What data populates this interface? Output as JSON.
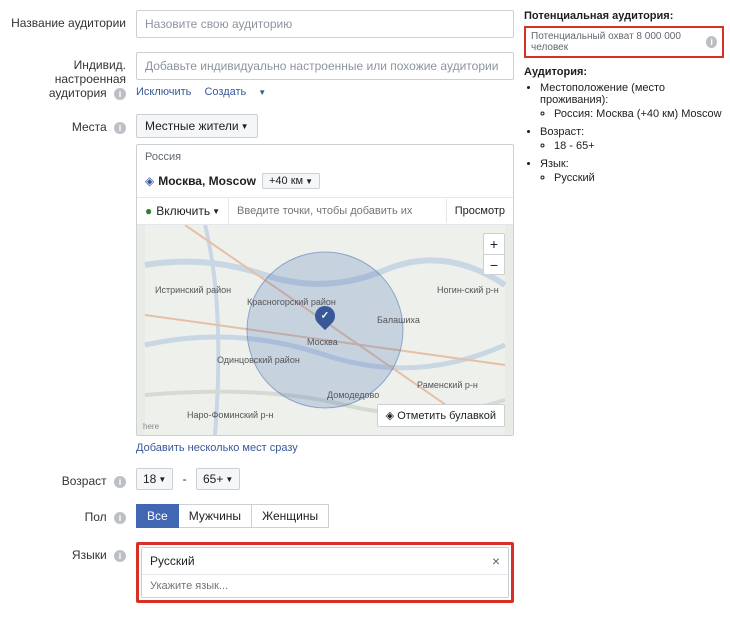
{
  "labels": {
    "audience_name": "Название аудитории",
    "custom_audience": "Индивид. настроенная аудитория",
    "locations": "Места",
    "age": "Возраст",
    "gender": "Пол",
    "languages": "Языки"
  },
  "audience_name": {
    "placeholder": "Назовите свою аудиторию"
  },
  "custom_audience": {
    "placeholder": "Добавьте индивидуально настроенные или похожие аудитории",
    "exclude": "Исключить",
    "create": "Создать"
  },
  "locations": {
    "residents_label": "Местные жители",
    "country": "Россия",
    "city": "Москва, Moscow",
    "radius": "+40 км",
    "include": "Включить",
    "points_placeholder": "Введите точки, чтобы добавить их",
    "browse": "Просмотр",
    "drop_pin": "Отметить булавкой",
    "add_bulk": "Добавить несколько мест сразу",
    "map_labels": {
      "istra": "Истринский район",
      "krasnogorsk": "Красногорский район",
      "odintsovo": "Одинцовский район",
      "moscow": "Москва",
      "balashikha": "Балашиха",
      "noginsk": "Ногин-ский р-н",
      "domodedovo": "Домодедово",
      "ramensky": "Раменский р-н",
      "narofominsk": "Наро-Фоминский р-н"
    },
    "here": "here"
  },
  "age": {
    "min": "18",
    "max": "65+"
  },
  "gender": {
    "all": "Все",
    "men": "Мужчины",
    "women": "Женщины"
  },
  "languages_box": {
    "value": "Русский",
    "placeholder": "Укажите язык..."
  },
  "side": {
    "potential_title": "Потенциальная аудитория:",
    "reach": "Потенциальный охват 8 000 000 человек",
    "audience_title": "Аудитория:",
    "loc_header": "Местоположение (место проживания):",
    "loc_value": "Россия: Москва (+40 км) Moscow",
    "age_header": "Возраст:",
    "age_value": "18 - 65+",
    "lang_header": "Язык:",
    "lang_value": "Русский"
  }
}
